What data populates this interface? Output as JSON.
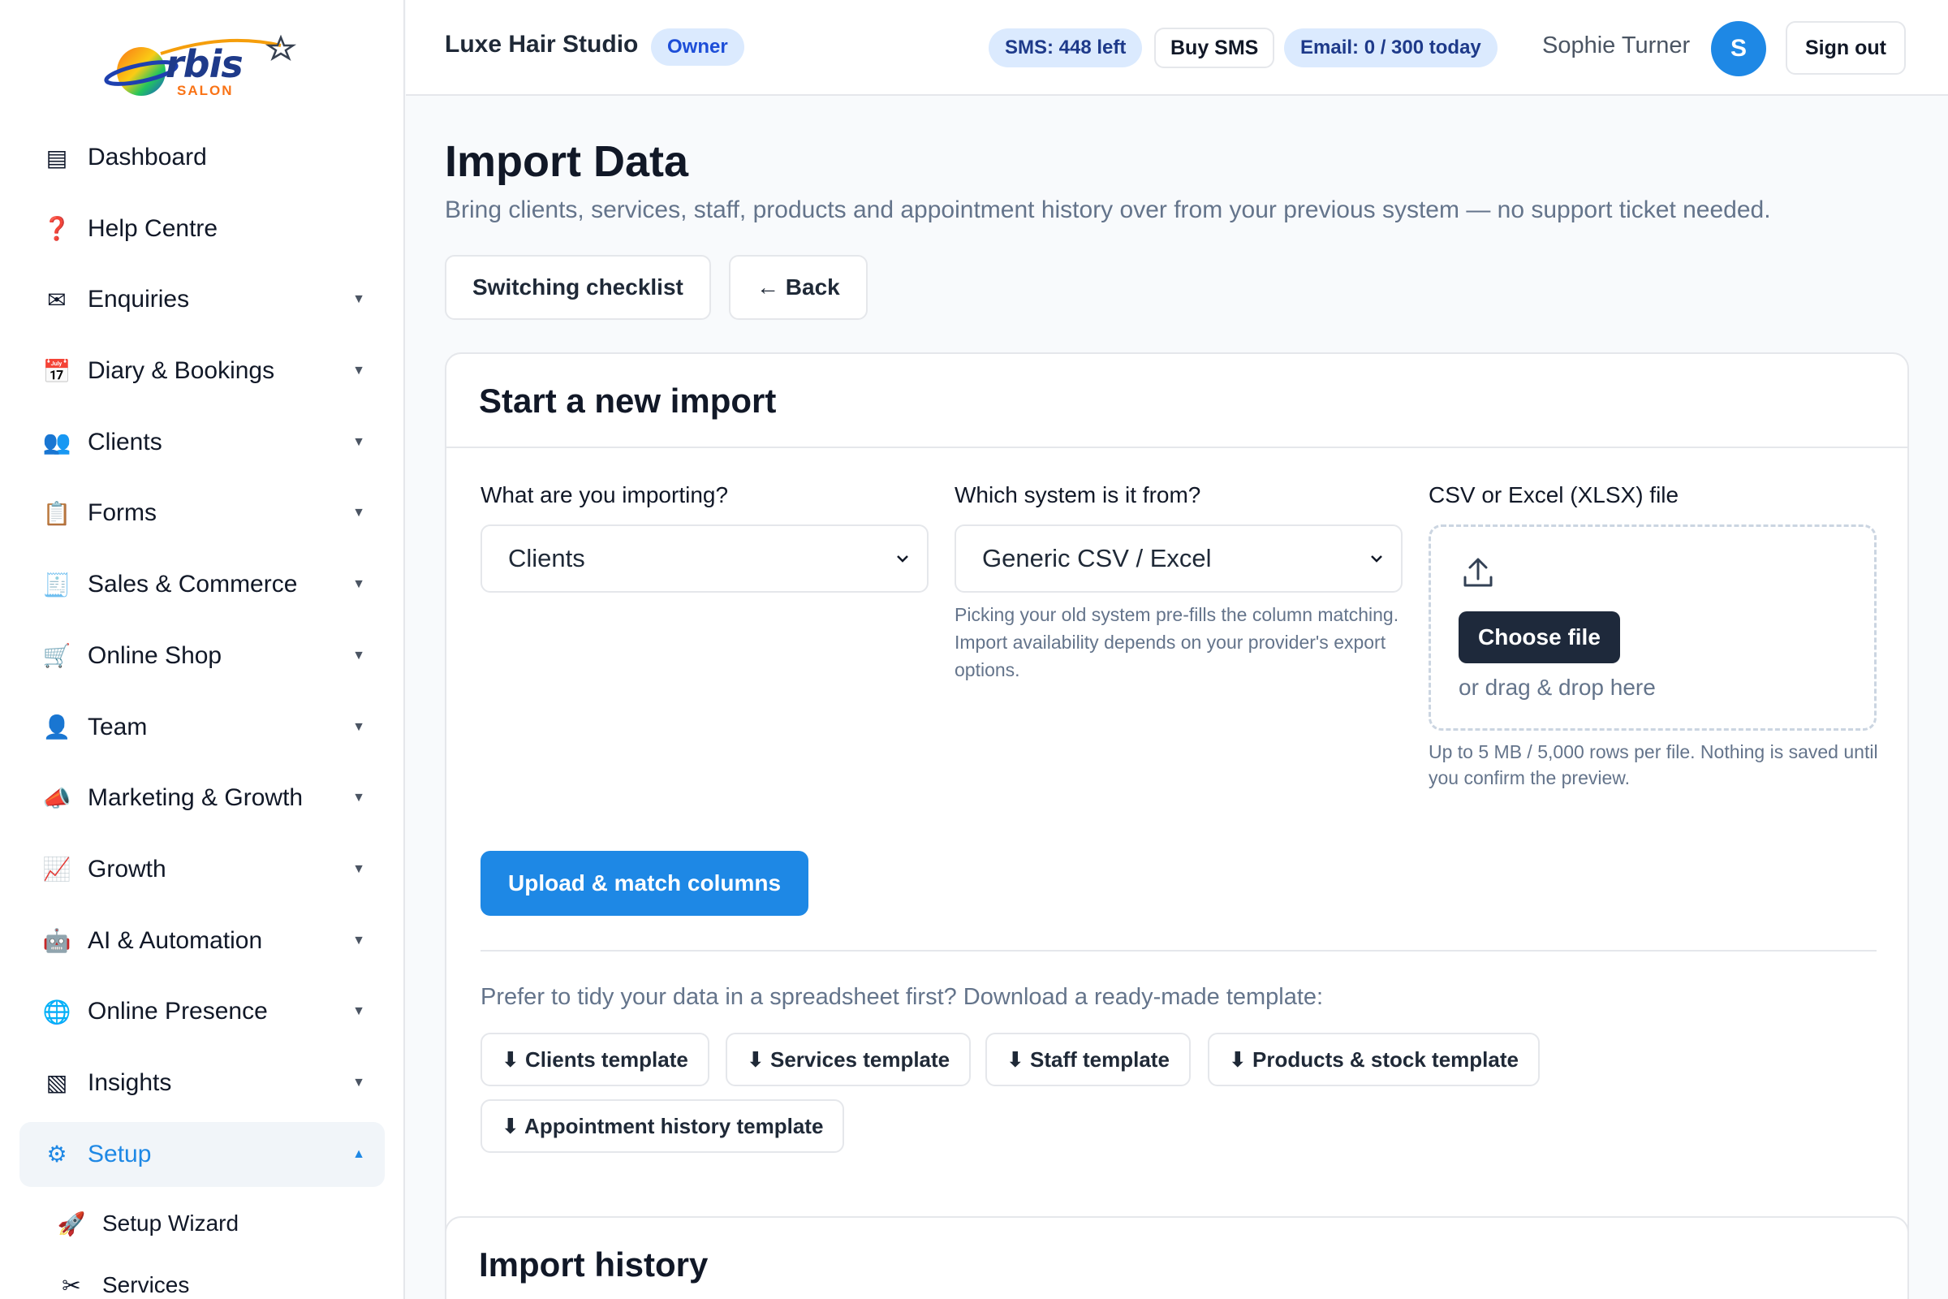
{
  "brand": {
    "logo_main": "rbis",
    "logo_letter": "O",
    "logo_sub": "SALON"
  },
  "topbar": {
    "studio_name": "Luxe Hair Studio",
    "role_badge": "Owner",
    "sms_pill": "SMS: 448 left",
    "buy_sms": "Buy SMS",
    "email_pill": "Email: 0 / 300 today",
    "user_name": "Sophie Turner",
    "avatar_initial": "S",
    "sign_out": "Sign out"
  },
  "sidebar": {
    "items": [
      {
        "label": "Dashboard",
        "icon": "dashboard-icon",
        "glyph": "▤",
        "caret": ""
      },
      {
        "label": "Help Centre",
        "icon": "help-icon",
        "glyph": "❓",
        "caret": ""
      },
      {
        "label": "Enquiries",
        "icon": "mail-icon",
        "glyph": "✉",
        "caret": "▼"
      },
      {
        "label": "Diary & Bookings",
        "icon": "calendar-icon",
        "glyph": "📅",
        "caret": "▼"
      },
      {
        "label": "Clients",
        "icon": "people-icon",
        "glyph": "👥",
        "caret": "▼"
      },
      {
        "label": "Forms",
        "icon": "clipboard-icon",
        "glyph": "📋",
        "caret": "▼"
      },
      {
        "label": "Sales & Commerce",
        "icon": "receipt-icon",
        "glyph": "🧾",
        "caret": "▼"
      },
      {
        "label": "Online Shop",
        "icon": "cart-icon",
        "glyph": "🛒",
        "caret": "▼"
      },
      {
        "label": "Team",
        "icon": "person-icon",
        "glyph": "👤",
        "caret": "▼"
      },
      {
        "label": "Marketing & Growth",
        "icon": "megaphone-icon",
        "glyph": "📣",
        "caret": "▼"
      },
      {
        "label": "Growth",
        "icon": "chart-up-icon",
        "glyph": "📈",
        "caret": "▼"
      },
      {
        "label": "AI & Automation",
        "icon": "robot-icon",
        "glyph": "🤖",
        "caret": "▼"
      },
      {
        "label": "Online Presence",
        "icon": "globe-icon",
        "glyph": "🌐",
        "caret": "▼"
      },
      {
        "label": "Insights",
        "icon": "insights-icon",
        "glyph": "▧",
        "caret": "▼"
      },
      {
        "label": "Setup",
        "icon": "gear-icon",
        "glyph": "⚙",
        "caret": "▲"
      }
    ],
    "sub_items": [
      {
        "label": "Setup Wizard",
        "icon": "rocket-icon",
        "glyph": "🚀"
      },
      {
        "label": "Services",
        "icon": "scissors-icon",
        "glyph": "✂"
      }
    ]
  },
  "page": {
    "title": "Import Data",
    "subtitle": "Bring clients, services, staff, products and appointment history over from your previous system — no support ticket needed.",
    "checklist_button": "Switching checklist",
    "back_button": "← Back"
  },
  "import_card": {
    "title": "Start a new import",
    "what_label": "What are you importing?",
    "what_value": "Clients",
    "system_label": "Which system is it from?",
    "system_value": "Generic CSV / Excel",
    "system_help": "Picking your old system pre-fills the column matching. Import availability depends on your provider's export options.",
    "file_label": "CSV or Excel (XLSX) file",
    "choose_file": "Choose file",
    "drag_text": "or drag & drop here",
    "file_help": "Up to 5 MB / 5,000 rows per file. Nothing is saved until you confirm the preview.",
    "upload_button": "Upload & match columns",
    "template_intro": "Prefer to tidy your data in a spreadsheet first? Download a ready-made template:",
    "templates": [
      "⬇ Clients template",
      "⬇ Services template",
      "⬇ Staff template",
      "⬇ Products & stock template",
      "⬇ Appointment history template"
    ]
  },
  "history_card": {
    "title": "Import history"
  },
  "colors": {
    "accent": "#1e88e5",
    "dark_button": "#1e293b",
    "pill_bg": "#dbeafe"
  }
}
